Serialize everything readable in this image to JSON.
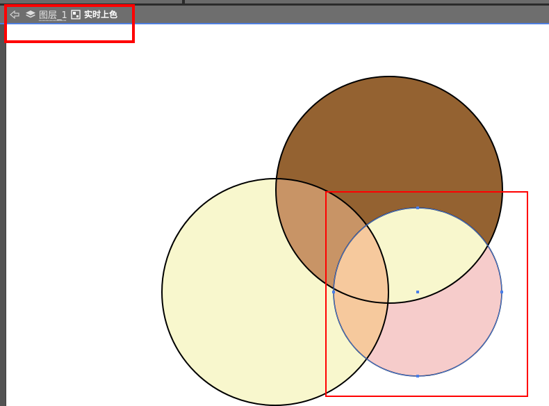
{
  "breadcrumb": {
    "back_icon": "back-arrow-icon",
    "layer_icon": "layers-icon",
    "layer_label": "图层_1",
    "live_paint_icon": "live-paint-group-icon",
    "live_paint_label": "实时上色"
  },
  "colors": {
    "brown_circle": "#946231",
    "cream_circle": "#F8F7CD",
    "pink_circle": "#F6CCCB",
    "overlap_brown_cream": "#C89466",
    "overlap_cream_pink": "#F6C99D",
    "selection_blue": "#4A7FE8",
    "annotation_red": "#FF0000"
  }
}
